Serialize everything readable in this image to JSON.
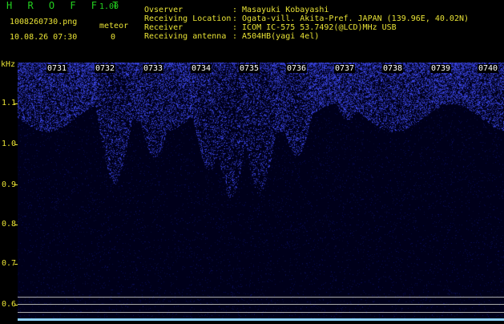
{
  "header": {
    "app_name": "H R O F F T",
    "version": "1.00",
    "filename": "1008260730.png",
    "meteor_label": "meteor",
    "datetime": "10.08.26 07:30",
    "meteor_count": "0",
    "info": [
      {
        "label": "Ovserver",
        "value": ": Masayuki Kobayashi"
      },
      {
        "label": "Receiving Location",
        "value": ": Ogata-vill. Akita-Pref. JAPAN (139.96E, 40.02N)"
      },
      {
        "label": "Receiver",
        "value": ": ICOM IC-575 53.7492(@LCD)MHz USB"
      },
      {
        "label": "Receiving antenna",
        "value": ": A504HB(yagi 4el)"
      }
    ]
  },
  "axis": {
    "unit": "kHz",
    "labels": [
      "1.1",
      "1.0",
      "0.9",
      "0.8",
      "0.7",
      "0.6"
    ]
  },
  "minute_labels": [
    "0731",
    "0732",
    "0733",
    "0734",
    "0735",
    "0736",
    "0737",
    "0738",
    "0739",
    "0740"
  ],
  "colors": {
    "header_green": "#23d11f",
    "header_yellow": "#e8e235",
    "signal_blue": "#2a3cff",
    "background": "#00001a"
  }
}
